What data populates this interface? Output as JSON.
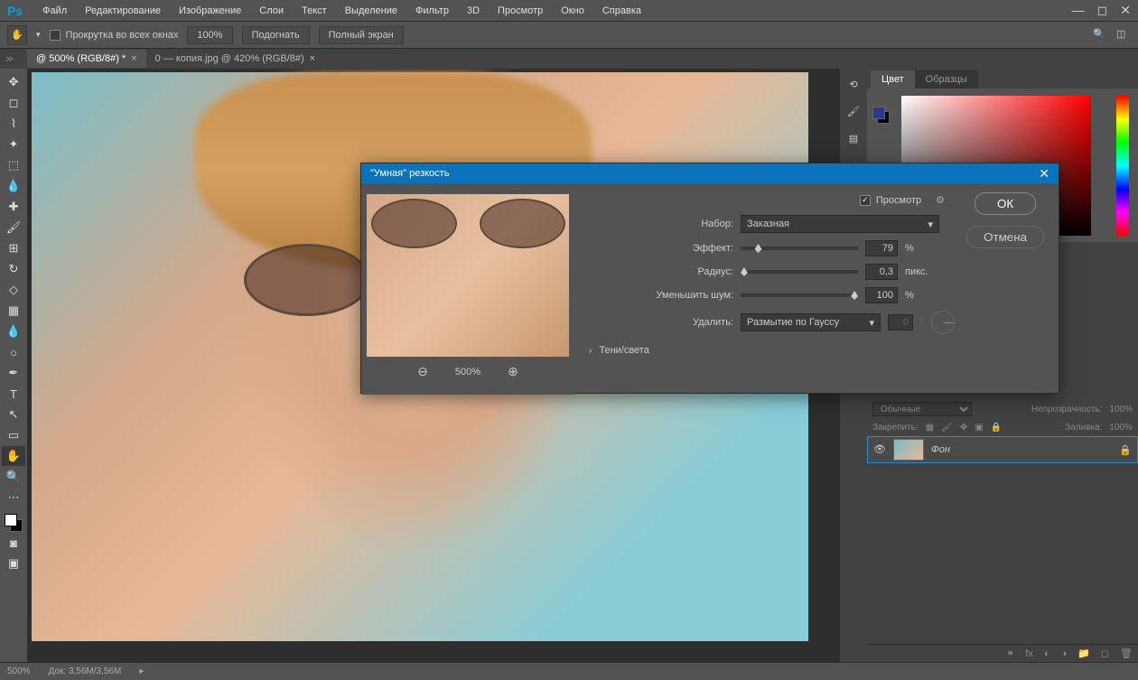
{
  "app": {
    "logo": "Ps"
  },
  "menu": [
    "Файл",
    "Редактирование",
    "Изображение",
    "Слои",
    "Текст",
    "Выделение",
    "Фильтр",
    "3D",
    "Просмотр",
    "Окно",
    "Справка"
  ],
  "options": {
    "scroll_all": "Прокрутка во всех окнах",
    "zoom_value": "100%",
    "fit": "Подогнать",
    "fullscreen": "Полный экран"
  },
  "tabs": [
    {
      "label": "@ 500% (RGB/8#) *",
      "active": true
    },
    {
      "label": "0 — копия.jpg @ 420% (RGB/8#)",
      "active": false
    }
  ],
  "dialog": {
    "title": "\"Умная\" резкость",
    "preview_label": "Просмотр",
    "ok": "ОК",
    "cancel": "Отмена",
    "preset_label": "Набор:",
    "preset_value": "Заказная",
    "effect_label": "Эффект:",
    "effect_value": "79",
    "effect_unit": "%",
    "radius_label": "Радиус:",
    "radius_value": "0,3",
    "radius_unit": "пикс.",
    "noise_label": "Уменьшить шум:",
    "noise_value": "100",
    "noise_unit": "%",
    "remove_label": "Удалить:",
    "remove_value": "Размытие по Гауссу",
    "angle_value": "0",
    "shadows_label": "Тени/света",
    "zoom_level": "500%"
  },
  "panels": {
    "color_tab": "Цвет",
    "swatches_tab": "Образцы",
    "blend_mode": "Обычные",
    "opacity_label": "Непрозрачность:",
    "opacity_value": "100%",
    "lock_label": "Закрепить:",
    "fill_label": "Заливка:",
    "fill_value": "100%",
    "layer_name": "Фон"
  },
  "status": {
    "zoom": "500%",
    "doc": "Док: 3,56M/3,56M"
  }
}
